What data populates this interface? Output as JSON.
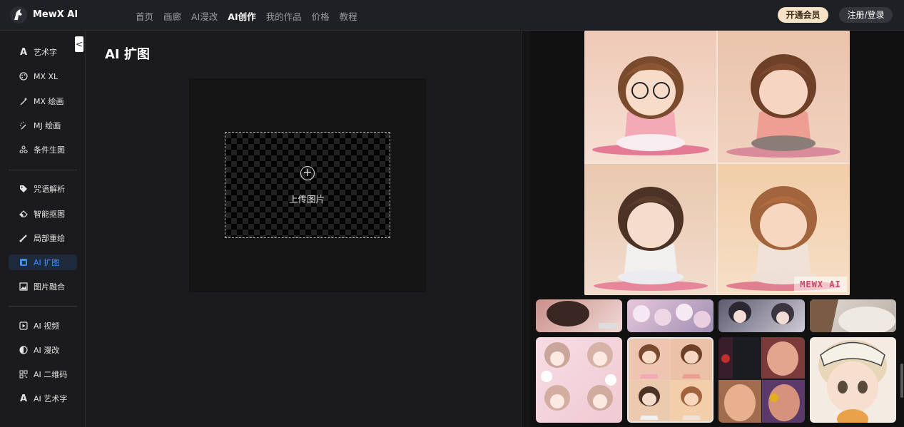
{
  "header": {
    "brand": "MewX AI",
    "nav": [
      "首页",
      "画廊",
      "AI漫改",
      "AI创作",
      "我的作品",
      "价格",
      "教程"
    ],
    "active_nav": "AI创作",
    "vip_button": "开通会员",
    "login_button": "注册/登录"
  },
  "sidebar": {
    "collapse_icon": "<",
    "group1": [
      {
        "label": "艺术字",
        "icon": "A"
      },
      {
        "label": "MX XL",
        "icon": "palette-icon"
      },
      {
        "label": "MX 绘画",
        "icon": "magic-wand-icon"
      },
      {
        "label": "MJ 绘画",
        "icon": "wand-icon"
      },
      {
        "label": "条件生图",
        "icon": "nodes-icon"
      }
    ],
    "group2": [
      {
        "label": "咒语解析",
        "icon": "tag-icon"
      },
      {
        "label": "智能抠图",
        "icon": "eraser-icon"
      },
      {
        "label": "局部重绘",
        "icon": "brush-icon"
      },
      {
        "label": "AI 扩图",
        "icon": "expand-icon",
        "active": true
      },
      {
        "label": "图片融合",
        "icon": "image-merge-icon"
      }
    ],
    "group3": [
      {
        "label": "AI 视频",
        "icon": "play-icon"
      },
      {
        "label": "AI 漫改",
        "icon": "half-circle-icon"
      },
      {
        "label": "AI 二维码",
        "icon": "qrcode-icon"
      },
      {
        "label": "AI 艺术字",
        "icon": "A"
      }
    ]
  },
  "main": {
    "title": "AI 扩图",
    "upload_label": "上传图片"
  },
  "preview": {
    "watermark": "MEWX AI"
  },
  "colors": {
    "accent": "#3d8bff",
    "vip_bg": "#f6e2c8"
  }
}
